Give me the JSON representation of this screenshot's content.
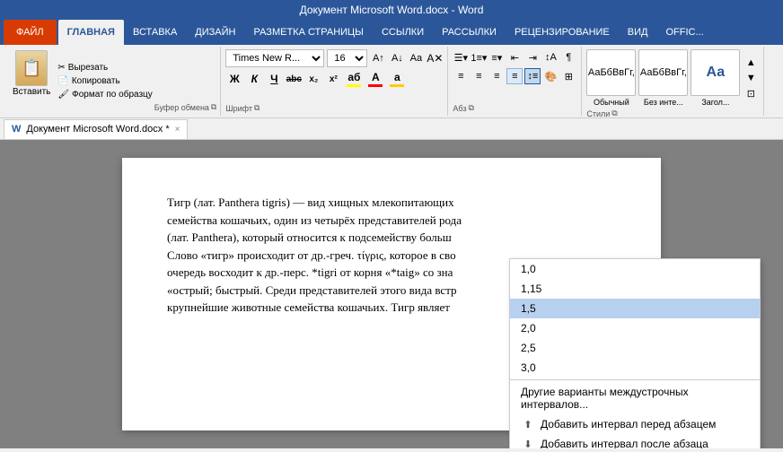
{
  "titleBar": {
    "text": "Документ Microsoft Word.docx - Word"
  },
  "tabs": [
    {
      "label": "ФАЙЛ",
      "id": "file",
      "type": "file"
    },
    {
      "label": "ГЛАВНАЯ",
      "id": "home",
      "active": true
    },
    {
      "label": "ВСТАВКА",
      "id": "insert"
    },
    {
      "label": "ДИЗАЙН",
      "id": "design"
    },
    {
      "label": "РАЗМЕТКА СТРАНИЦЫ",
      "id": "layout"
    },
    {
      "label": "ССЫЛКИ",
      "id": "references"
    },
    {
      "label": "РАССЫЛКИ",
      "id": "mailings"
    },
    {
      "label": "РЕЦЕНЗИРОВАНИЕ",
      "id": "review"
    },
    {
      "label": "ВИД",
      "id": "view"
    },
    {
      "label": "OFFIC...",
      "id": "office"
    }
  ],
  "ribbon": {
    "clipboard": {
      "label": "Буфер обмена",
      "paste_label": "Вставить",
      "cut_label": "Вырезать",
      "copy_label": "Копировать",
      "format_label": "Формат по образцу"
    },
    "font": {
      "label": "Шрифт",
      "font_name": "Times New R...",
      "font_size": "16",
      "bold": "Ж",
      "italic": "К",
      "underline": "Ч",
      "strikethrough": "abc",
      "subscript": "x₂",
      "superscript": "x²"
    },
    "paragraph": {
      "label": "Абз"
    },
    "styles": {
      "label": "Стили",
      "normal_label": "АаБбВвГг,",
      "normal_name": "Обычный",
      "nospace_label": "АаБбВвГг,",
      "nospace_name": "Без инте...",
      "heading_label": "Аа",
      "heading_name": "Загол..."
    }
  },
  "docTab": {
    "title": "Документ Microsoft Word.docx *",
    "close": "×"
  },
  "pageContent": {
    "line1": "Тигр (лат. Panthera tigris",
    "line1cont": ") — вид хищных млекопитающих",
    "line2": "семейства кошачьих, од",
    "line2cont": "ин из четырёх представителей рода",
    "line3": "(лат. Panthera), который относится к подсемейству больш",
    "line4": "Слово «тигр» происходит от др.-греч. τίγρις, которое в сво",
    "line5": "очередь восходит к др.-перс. *tigri от корня «*taig» со зна",
    "line6": "«острый; быстрый. Среди представителей этого вида встр",
    "line7": "крупнейшие животные семейства кошачьих. Тигр являет"
  },
  "dropdown": {
    "items": [
      {
        "value": "1,0",
        "id": "1.0",
        "selected": false
      },
      {
        "value": "1,15",
        "id": "1.15",
        "selected": false
      },
      {
        "value": "1,5",
        "id": "1.5",
        "selected": true
      },
      {
        "value": "2,0",
        "id": "2.0",
        "selected": false
      },
      {
        "value": "2,5",
        "id": "2.5",
        "selected": false
      },
      {
        "value": "3,0",
        "id": "3.0",
        "selected": false
      }
    ],
    "divider": true,
    "actions": [
      {
        "label": "Другие варианты междустрочных интервалов...",
        "icon": ""
      },
      {
        "label": "Добавить интервал перед абзацем",
        "icon": "⬆"
      },
      {
        "label": "Добавить интервал после абзаца",
        "icon": "⬇"
      }
    ]
  },
  "colors": {
    "accent": "#2b579a",
    "fileTab": "#d83b01",
    "selectedItem": "#b8d0f0",
    "fontColorA": "#ff0000",
    "highlightColor": "#ffff00",
    "textColorBar": "#ff0000"
  }
}
